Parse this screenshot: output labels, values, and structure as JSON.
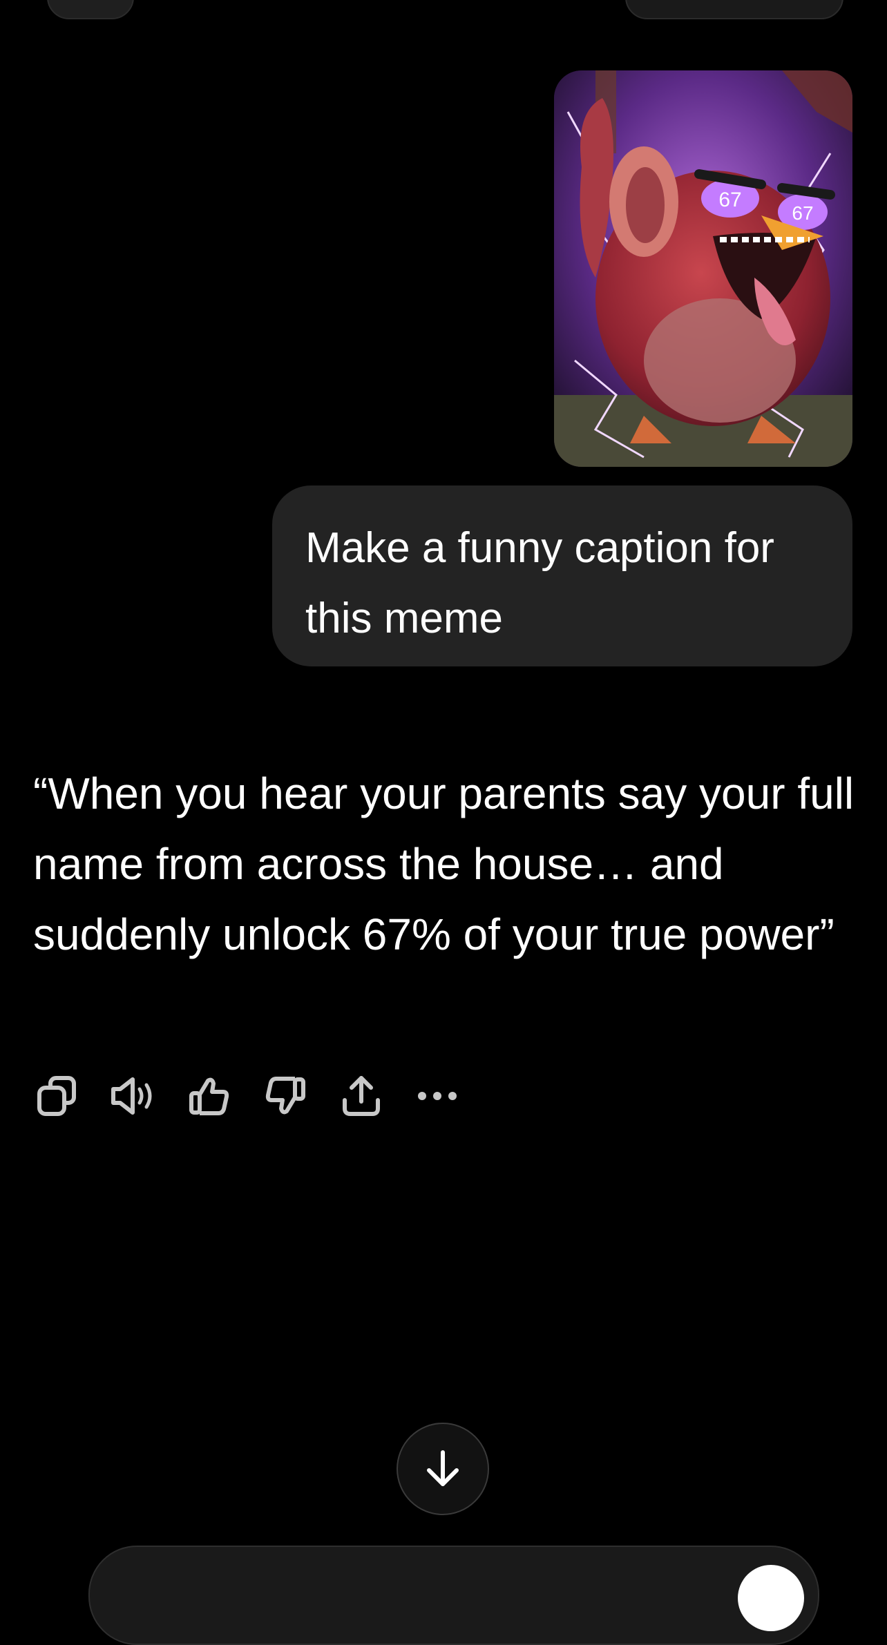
{
  "conversation": {
    "user_message": {
      "image_icon": "meme-image-icon",
      "text": "Make a funny caption for this meme"
    },
    "assistant_message": {
      "text": "“When you hear your parents say your full name from across the house… and suddenly unlock 67% of your true power”"
    }
  },
  "image_content": {
    "badge_left": "67",
    "badge_right": "67"
  },
  "actions": [
    {
      "name": "copy-icon"
    },
    {
      "name": "read-aloud-icon"
    },
    {
      "name": "thumbs-up-icon"
    },
    {
      "name": "thumbs-down-icon"
    },
    {
      "name": "share-icon"
    },
    {
      "name": "more-icon"
    }
  ],
  "scroll_down": {
    "icon": "arrow-down-icon"
  },
  "colors": {
    "background": "#000000",
    "user_bubble": "#232323",
    "text": "#ffffff",
    "icon": "#c8c8c8"
  }
}
